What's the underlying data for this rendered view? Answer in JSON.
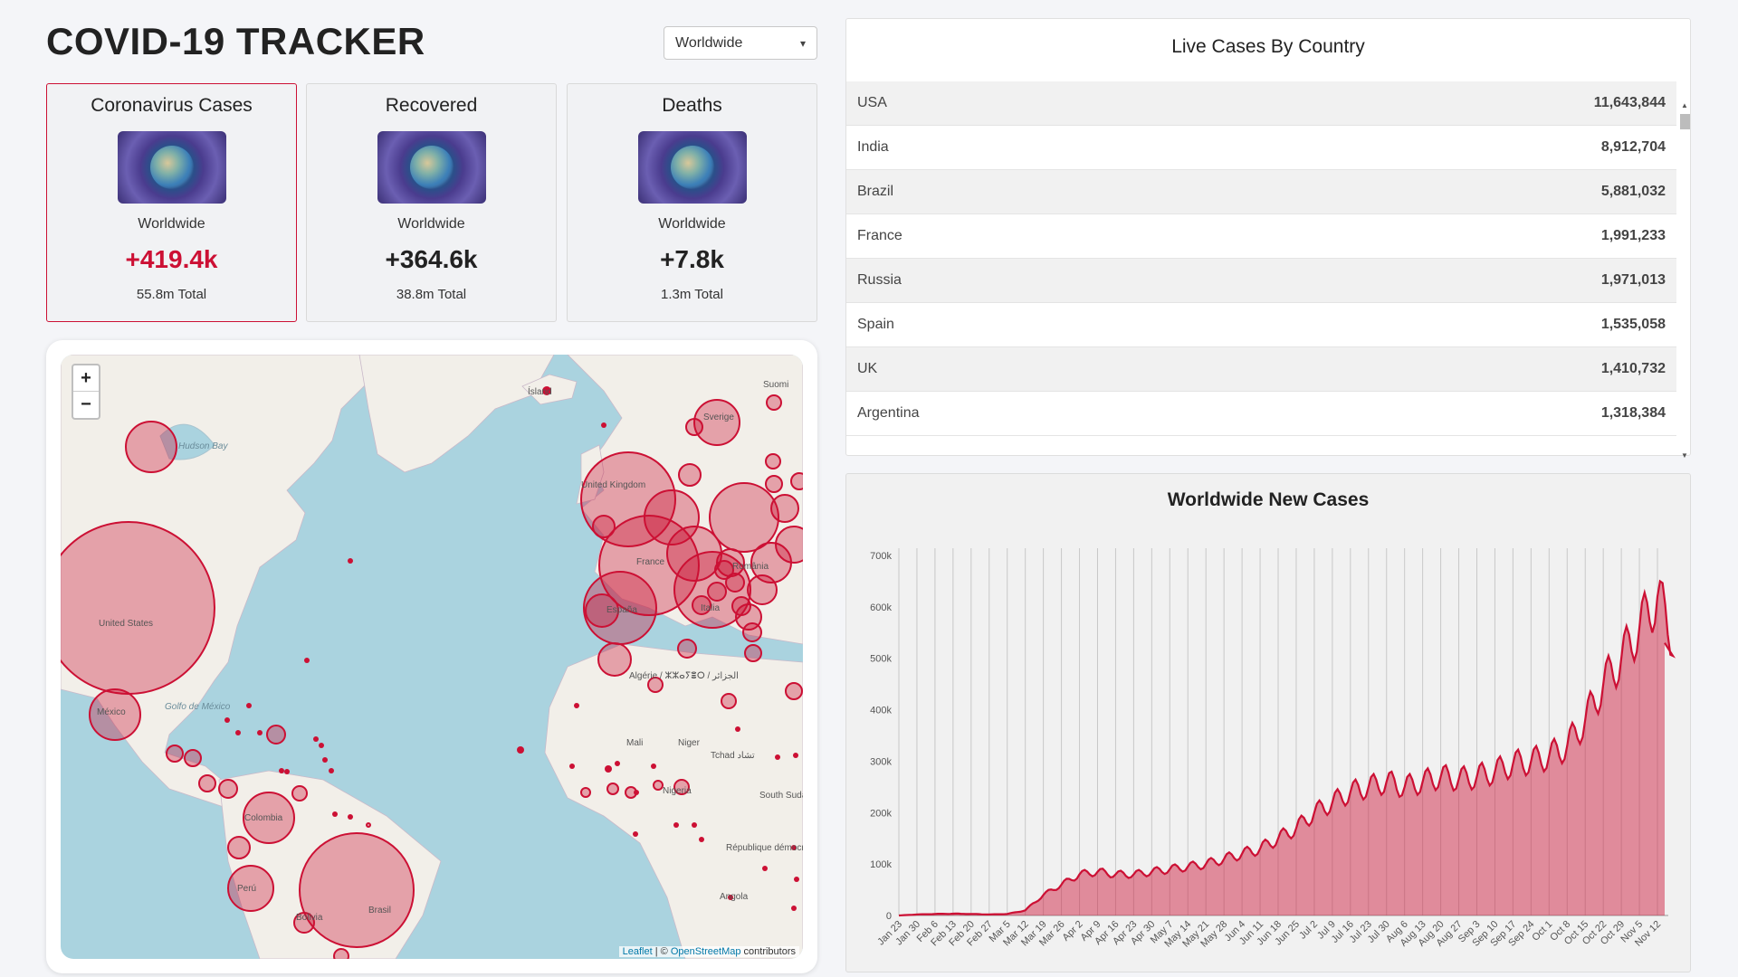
{
  "app": {
    "title": "COVID-19 TRACKER"
  },
  "country_select": {
    "selected": "Worldwide",
    "chevron_icon": "chevron-down-icon"
  },
  "cards": [
    {
      "title": "Coronavirus Cases",
      "scope": "Worldwide",
      "new": "+419.4k",
      "total": "55.8m Total",
      "active": true
    },
    {
      "title": "Recovered",
      "scope": "Worldwide",
      "new": "+364.6k",
      "total": "38.8m Total",
      "active": false
    },
    {
      "title": "Deaths",
      "scope": "Worldwide",
      "new": "+7.8k",
      "total": "1.3m Total",
      "active": false
    }
  ],
  "map": {
    "zoom_in": "+",
    "zoom_out": "−",
    "attribution_leaflet": "Leaflet",
    "attribution_sep": " | © ",
    "attribution_osm": "OpenStreetMap",
    "attribution_rest": " contributors",
    "labels": [
      "Ísland",
      "Suomi",
      "Sverige",
      "United Kingdom",
      "France",
      "España",
      "Italia",
      "România",
      "Algérie / ⵣⵣⴰⵢⴻⵔ / الجزائر",
      "Mali",
      "Niger",
      "Tchad تشاد",
      "Nigeria",
      "South Sudan",
      "République démocratique du Congo",
      "Angola",
      "United States",
      "México",
      "Colombia",
      "Perú",
      "Bolivia",
      "Brasil",
      "Hudson Bay",
      "Golfo de México"
    ],
    "circle_color": "#cc1034"
  },
  "table": {
    "title": "Live Cases By Country",
    "rows": [
      {
        "country": "USA",
        "cases": "11,643,844"
      },
      {
        "country": "India",
        "cases": "8,912,704"
      },
      {
        "country": "Brazil",
        "cases": "5,881,032"
      },
      {
        "country": "France",
        "cases": "1,991,233"
      },
      {
        "country": "Russia",
        "cases": "1,971,013"
      },
      {
        "country": "Spain",
        "cases": "1,535,058"
      },
      {
        "country": "UK",
        "cases": "1,410,732"
      },
      {
        "country": "Argentina",
        "cases": "1,318,384"
      }
    ]
  },
  "chart_data": {
    "type": "area",
    "title": "Worldwide New Cases",
    "xlabel": "",
    "ylabel": "",
    "ylim": [
      0,
      700000
    ],
    "y_ticks": [
      "0",
      "100k",
      "200k",
      "300k",
      "400k",
      "500k",
      "600k",
      "700k"
    ],
    "x_ticks": [
      "Jan 23",
      "Jan 30",
      "Feb 6",
      "Feb 13",
      "Feb 20",
      "Feb 27",
      "Mar 5",
      "Mar 12",
      "Mar 19",
      "Mar 26",
      "Apr 2",
      "Apr 9",
      "Apr 16",
      "Apr 23",
      "Apr 30",
      "May 7",
      "May 14",
      "May 21",
      "May 28",
      "Jun 4",
      "Jun 11",
      "Jun 18",
      "Jun 25",
      "Jul 2",
      "Jul 9",
      "Jul 16",
      "Jul 23",
      "Jul 30",
      "Aug 6",
      "Aug 13",
      "Aug 20",
      "Aug 27",
      "Sep 3",
      "Sep 10",
      "Sep 17",
      "Sep 24",
      "Oct 1",
      "Oct 8",
      "Oct 15",
      "Oct 22",
      "Oct 29",
      "Nov 5",
      "Nov 12"
    ],
    "weekly_values": [
      0,
      2000,
      3000,
      3500,
      3000,
      2000,
      3000,
      10000,
      40000,
      60000,
      80000,
      85000,
      80000,
      80000,
      85000,
      90000,
      95000,
      100000,
      110000,
      120000,
      130000,
      150000,
      170000,
      200000,
      220000,
      240000,
      250000,
      260000,
      250000,
      260000,
      270000,
      265000,
      270000,
      280000,
      295000,
      300000,
      310000,
      330000,
      380000,
      450000,
      500000,
      560000,
      620000
    ],
    "last_value": 530000,
    "grid": "vertical",
    "fill_color": "#cc1034",
    "fill_opacity": 0.45,
    "line_color": "#cc1034"
  }
}
